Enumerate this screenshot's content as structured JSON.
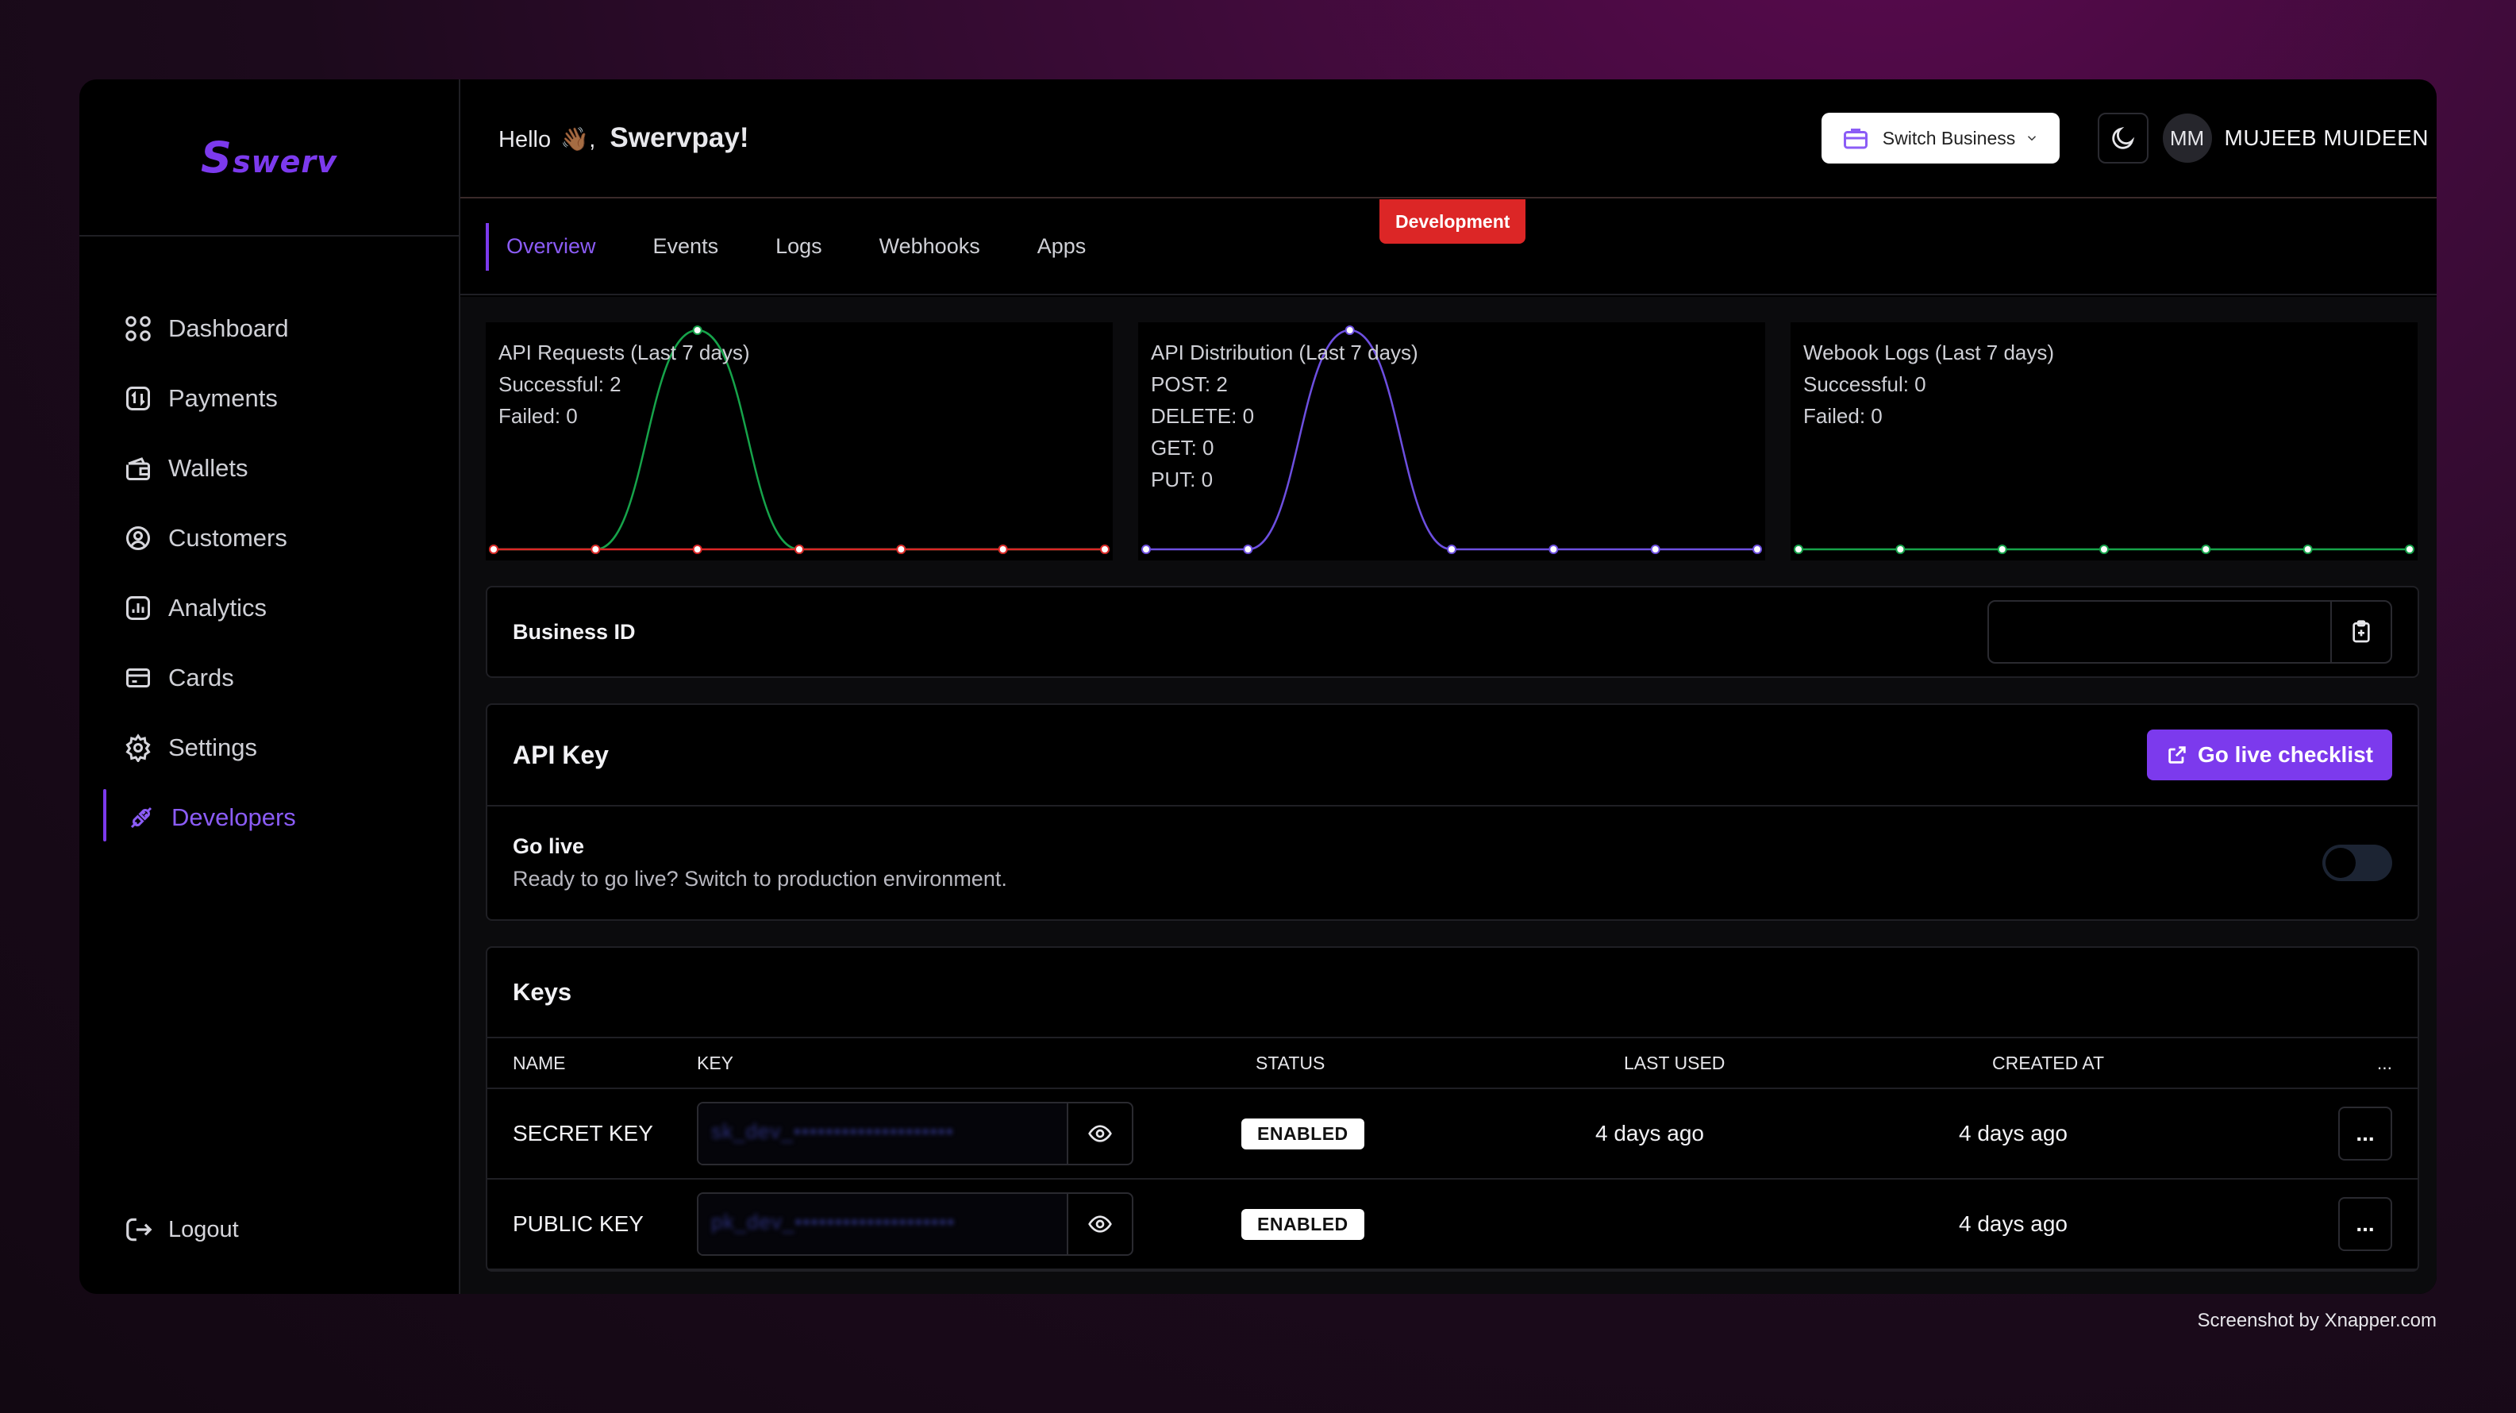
{
  "brand": {
    "logo_text": "swerv"
  },
  "sidebar": {
    "items": [
      {
        "label": "Dashboard",
        "icon": "dashboard-icon"
      },
      {
        "label": "Payments",
        "icon": "payments-icon"
      },
      {
        "label": "Wallets",
        "icon": "wallet-icon"
      },
      {
        "label": "Customers",
        "icon": "customer-icon"
      },
      {
        "label": "Analytics",
        "icon": "analytics-icon"
      },
      {
        "label": "Cards",
        "icon": "card-icon"
      },
      {
        "label": "Settings",
        "icon": "gear-icon"
      },
      {
        "label": "Developers",
        "icon": "developers-icon"
      }
    ],
    "active": "Developers",
    "logout_label": "Logout"
  },
  "header": {
    "greeting": "Hello",
    "wave": "👋🏾,",
    "business_name": "Swervpay!",
    "switch_business_label": "Switch Business",
    "avatar_initials": "MM",
    "username": "MUJEEB MUIDEEN",
    "env_badge": "Development"
  },
  "tabs": [
    {
      "label": "Overview"
    },
    {
      "label": "Events"
    },
    {
      "label": "Logs"
    },
    {
      "label": "Webhooks"
    },
    {
      "label": "Apps"
    }
  ],
  "colors": {
    "accent": "#7c3aed",
    "success_line": "#16a34a",
    "failed_line": "#dc2626",
    "distribution_line": "#6d4fe0",
    "badge_red": "#dc2626"
  },
  "chart_data": [
    {
      "type": "line",
      "title": "API Requests (Last 7 days)",
      "stats": [
        "Successful: 2",
        "Failed: 0"
      ],
      "series": [
        {
          "name": "Successful",
          "values": [
            0,
            0,
            2,
            0,
            0,
            0,
            0
          ]
        },
        {
          "name": "Failed",
          "values": [
            0,
            0,
            0,
            0,
            0,
            0,
            0
          ]
        }
      ],
      "ylim": [
        0,
        2
      ]
    },
    {
      "type": "line",
      "title": "API Distribution (Last 7 days)",
      "stats": [
        "POST: 2",
        "DELETE: 0",
        "GET: 0",
        "PUT: 0"
      ],
      "series": [
        {
          "name": "POST",
          "values": [
            0,
            0,
            2,
            0,
            0,
            0,
            0
          ]
        }
      ],
      "ylim": [
        0,
        2
      ]
    },
    {
      "type": "line",
      "title": "Webook Logs (Last 7 days)",
      "stats": [
        "Successful: 0",
        "Failed: 0"
      ],
      "series": [
        {
          "name": "Successful",
          "values": [
            0,
            0,
            0,
            0,
            0,
            0,
            0
          ]
        }
      ],
      "ylim": [
        0,
        2
      ]
    }
  ],
  "business_id": {
    "label": "Business ID",
    "value": ""
  },
  "api_key": {
    "title": "API Key",
    "go_live_button": "Go live checklist",
    "go_live_title": "Go live",
    "go_live_description": "Ready to go live? Switch to production environment.",
    "toggle_on": false
  },
  "keys": {
    "title": "Keys",
    "columns": [
      "NAME",
      "KEY",
      "STATUS",
      "LAST USED",
      "CREATED AT",
      "..."
    ],
    "rows": [
      {
        "name": "SECRET KEY",
        "key_masked": "sk_dev_••••••••••••••••••••",
        "status": "ENABLED",
        "last_used": "4 days ago",
        "created_at": "4 days ago"
      },
      {
        "name": "PUBLIC KEY",
        "key_masked": "pk_dev_••••••••••••••••••••",
        "status": "ENABLED",
        "last_used": "",
        "created_at": "4 days ago"
      }
    ],
    "row_menu": "..."
  },
  "footer_note": "Screenshot by Xnapper.com"
}
